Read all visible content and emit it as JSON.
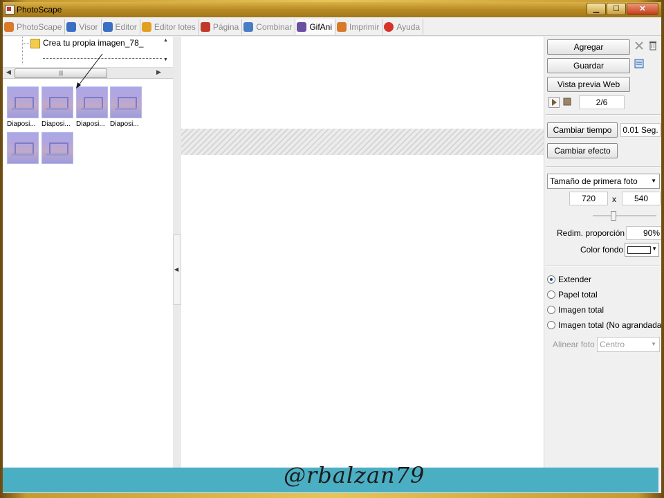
{
  "window": {
    "title": "PhotoScape"
  },
  "window_controls": {
    "minimize": "▁",
    "maximize": "☐",
    "close": "✕"
  },
  "tabs": [
    {
      "label": "PhotoScape",
      "icon": "photoscape-icon",
      "color": "#d9792a"
    },
    {
      "label": "Visor",
      "icon": "viewer-icon",
      "color": "#3a6fc4"
    },
    {
      "label": "Editor",
      "icon": "editor-icon",
      "color": "#3a6fc4"
    },
    {
      "label": "Editor lotes",
      "icon": "batch-editor-icon",
      "color": "#e1a020"
    },
    {
      "label": "Página",
      "icon": "page-icon",
      "color": "#c0392b"
    },
    {
      "label": "Combinar",
      "icon": "combine-icon",
      "color": "#4a7cc6"
    },
    {
      "label": "GifAni",
      "icon": "gifani-icon",
      "color": "#6a4fa3"
    },
    {
      "label": "Imprimir",
      "icon": "print-icon",
      "color": "#d9792a"
    },
    {
      "label": "Ayuda",
      "icon": "help-icon",
      "color": "#d6332b"
    }
  ],
  "tree": {
    "folder_label": "Crea tu propia imagen_78_"
  },
  "thumbnails": [
    {
      "caption": "Diaposi..."
    },
    {
      "caption": "Diaposi..."
    },
    {
      "caption": "Diaposi..."
    },
    {
      "caption": "Diaposi..."
    },
    {
      "caption": ""
    },
    {
      "caption": ""
    }
  ],
  "right_panel": {
    "add_label": "Agregar",
    "save_label": "Guardar",
    "preview_label": "Vista previa Web",
    "frame_counter": "2/6",
    "change_time_label": "Cambiar tiempo",
    "time_value": "0.01 Seg.",
    "change_effect_label": "Cambiar efecto",
    "size_select": "Tamaño de primera foto",
    "width": "720",
    "x_sep": "x",
    "height": "540",
    "resize_label": "Redim. proporción",
    "resize_value": "90%",
    "bg_color_label": "Color fondo",
    "bg_color": "#ffffff",
    "radios": [
      {
        "label": "Extender",
        "selected": true
      },
      {
        "label": "Papel total",
        "selected": false
      },
      {
        "label": "Imagen total",
        "selected": false
      },
      {
        "label": "Imagen total (No agrandada)",
        "selected": false
      }
    ],
    "align_label": "Alinear foto",
    "align_value": "Centro"
  },
  "watermark": "@rbalzan79"
}
